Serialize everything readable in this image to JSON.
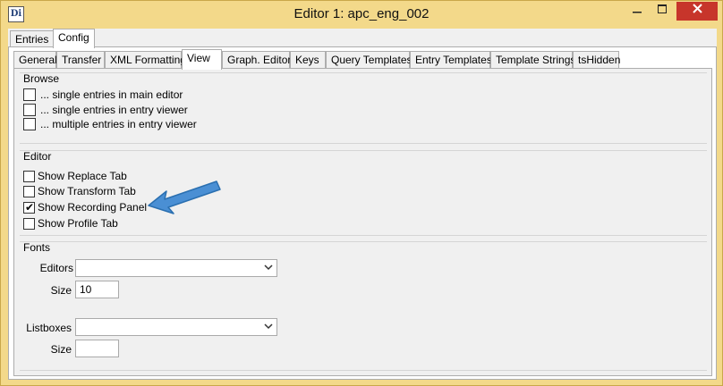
{
  "window": {
    "icon_label": "Di",
    "title": "Editor 1: apc_eng_002",
    "minimize_icon": "minimize-icon",
    "maximize_icon": "maximize-icon",
    "close_icon": "close-icon"
  },
  "top_tabs": [
    {
      "label": "Entries",
      "active": false
    },
    {
      "label": "Config",
      "active": true
    }
  ],
  "config_tabs": [
    {
      "label": "General",
      "active": false
    },
    {
      "label": "Transfer",
      "active": false
    },
    {
      "label": "XML Formatting",
      "active": false
    },
    {
      "label": "View",
      "active": true
    },
    {
      "label": "Graph. Editor",
      "active": false
    },
    {
      "label": "Keys",
      "active": false
    },
    {
      "label": "Query Templates",
      "active": false
    },
    {
      "label": "Entry Templates",
      "active": false
    },
    {
      "label": "Template Strings",
      "active": false
    },
    {
      "label": "tsHidden",
      "active": false
    }
  ],
  "browse": {
    "label": "Browse",
    "options": [
      {
        "label": "... single entries in main editor",
        "checked": false
      },
      {
        "label": "... single entries in entry viewer",
        "checked": false
      },
      {
        "label": "... multiple entries in entry viewer",
        "checked": false
      }
    ]
  },
  "editor": {
    "label": "Editor",
    "options": [
      {
        "label": "Show Replace Tab",
        "checked": false
      },
      {
        "label": "Show Transform Tab",
        "checked": false
      },
      {
        "label": "Show Recording Panel",
        "checked": true
      },
      {
        "label": "Show Profile Tab",
        "checked": false
      }
    ]
  },
  "fonts": {
    "label": "Fonts",
    "editors_label": "Editors",
    "editors_value": "",
    "editors_size_label": "Size",
    "editors_size_value": "10",
    "listboxes_label": "Listboxes",
    "listboxes_value": "",
    "listboxes_size_label": "Size",
    "listboxes_size_value": ""
  },
  "annotation": {
    "icon": "blue-arrow-icon",
    "color": "#4a8fd4"
  },
  "colors": {
    "title_bar": "#f3d98a",
    "close_button": "#c7352b",
    "check_mark": "✔"
  }
}
